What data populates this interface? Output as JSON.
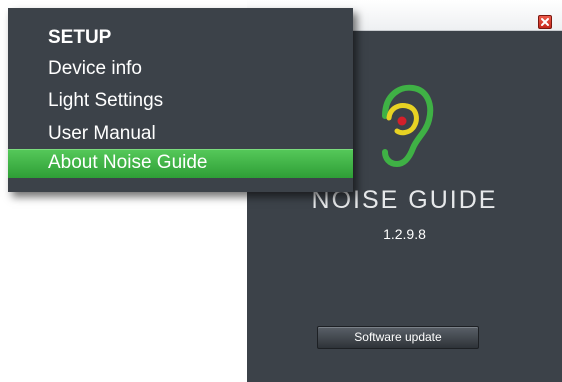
{
  "about_window": {
    "app_name": "NOISE GUIDE",
    "version": "1.2.9.8",
    "update_button_label": "Software update",
    "close_icon": "close-icon",
    "logo_icon": "ear-logo-icon"
  },
  "setup_menu": {
    "title": "SETUP",
    "items": [
      {
        "label": "Device info",
        "selected": false
      },
      {
        "label": "Light Settings",
        "selected": false
      },
      {
        "label": "User Manual",
        "selected": false
      },
      {
        "label": "About Noise Guide",
        "selected": true
      }
    ]
  },
  "colors": {
    "panel_bg": "#3c4249",
    "highlight_green": "#3fb145",
    "logo_green": "#3fb145",
    "logo_yellow": "#e8d223",
    "logo_dot_red": "#d4202a",
    "close_red": "#d8392a"
  }
}
